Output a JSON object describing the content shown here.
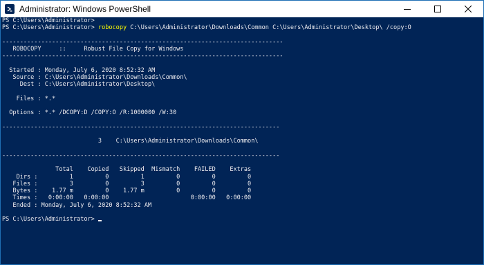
{
  "window": {
    "title": "Administrator: Windows PowerShell",
    "controls": [
      "minimize-icon",
      "maximize-icon",
      "close-icon"
    ]
  },
  "theme": {
    "background": "#012456",
    "text": "#EEEDF0",
    "command_highlight": "#FFFF00"
  },
  "console": {
    "lines": [
      "PS C:\\Users\\Administrator>",
      "",
      "",
      "-------------------------------------------------------------------------------",
      "   ROBOCOPY     ::     Robust File Copy for Windows",
      "-------------------------------------------------------------------------------",
      "",
      "  Started : Monday, July 6, 2020 8:52:32 AM",
      "   Source : C:\\Users\\Administrator\\Downloads\\Common\\",
      "     Dest : C:\\Users\\Administrator\\Desktop\\",
      "",
      "    Files : *.*",
      "",
      "  Options : *.* /DCOPY:D /COPY:O /R:1000000 /W:30",
      "",
      "------------------------------------------------------------------------------",
      "",
      "                           3    C:\\Users\\Administrator\\Downloads\\Common\\",
      "",
      "------------------------------------------------------------------------------",
      "",
      "               Total    Copied   Skipped  Mismatch    FAILED    Extras",
      "    Dirs :         1         0         1         0         0         0",
      "   Files :         3         0         3         0         0         0",
      "   Bytes :    1.77 m         0    1.77 m         0         0         0",
      "   Times :   0:00:00   0:00:00                       0:00:00   0:00:00",
      "   Ended : Monday, July 6, 2020 8:52:32 AM",
      "",
      "PS C:\\Users\\Administrator>"
    ],
    "command_prompt": "PS C:\\Users\\Administrator>",
    "command_name": "robocopy",
    "command_args": " C:\\Users\\Administrator\\Downloads\\Common C:\\Users\\Administrator\\Desktop\\ /copy:O",
    "final_prompt": "PS C:\\Users\\Administrator>"
  }
}
